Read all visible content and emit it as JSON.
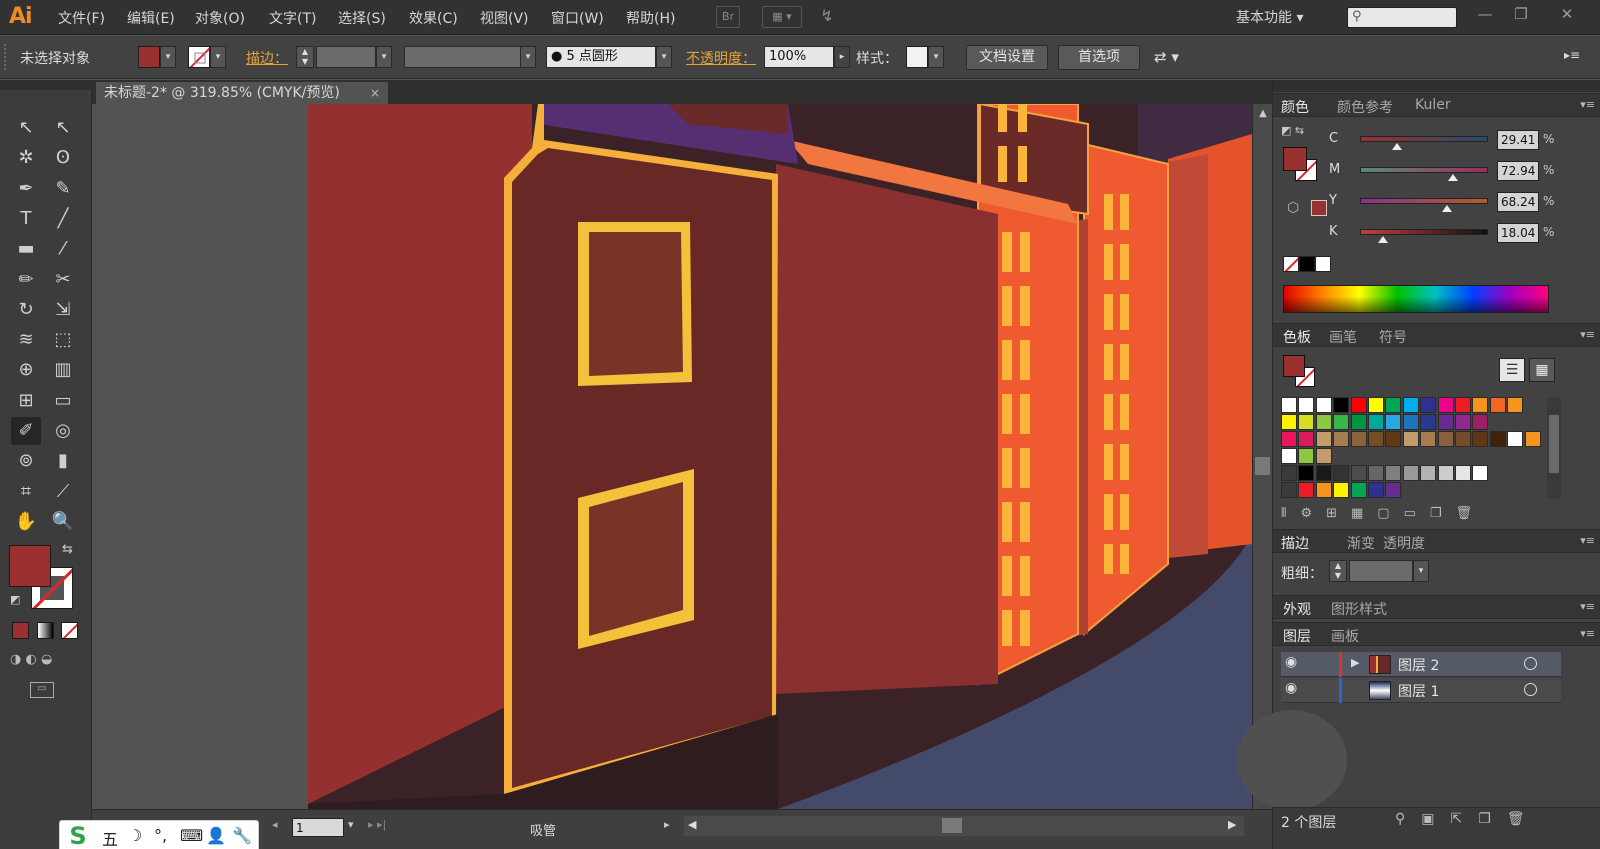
{
  "app": {
    "logo": "Ai",
    "menu": [
      "文件(F)",
      "编辑(E)",
      "对象(O)",
      "文字(T)",
      "选择(S)",
      "效果(C)",
      "视图(V)",
      "窗口(W)",
      "帮助(H)"
    ],
    "bridge_label": "Br",
    "workspace": "基本功能",
    "search_placeholder": "",
    "window_buttons": [
      "—",
      "❐",
      "✕"
    ]
  },
  "control_bar": {
    "selection_status": "未选择对象",
    "fill_color": "#9a3030",
    "stroke_label": "描边：",
    "brush_label": "5 点圆形",
    "opacity_label": "不透明度：",
    "opacity_value": "100%",
    "style_label": "样式：",
    "doc_setup_button": "文档设置",
    "preferences_button": "首选项"
  },
  "document": {
    "tab_title": "未标题-2* @ 319.85% (CMYK/预览)",
    "tab_close": "×",
    "page_number": "1",
    "status_tool": "吸管"
  },
  "ime": {
    "logo": "S",
    "items": [
      "五",
      "☽",
      "°,",
      "⌨",
      "👤",
      "🔧"
    ]
  },
  "toolbox": {
    "fill_color": "#9a3030",
    "tools": [
      {
        "name": "selection-tool",
        "glyph": "↖"
      },
      {
        "name": "direct-selection-tool",
        "glyph": "↖"
      },
      {
        "name": "magic-wand-tool",
        "glyph": "✲"
      },
      {
        "name": "lasso-tool",
        "glyph": "ʘ"
      },
      {
        "name": "pen-tool",
        "glyph": "✒"
      },
      {
        "name": "curvature-tool",
        "glyph": "✎"
      },
      {
        "name": "type-tool",
        "glyph": "T"
      },
      {
        "name": "line-tool",
        "glyph": "╱"
      },
      {
        "name": "rectangle-tool",
        "glyph": "▬"
      },
      {
        "name": "paintbrush-tool",
        "glyph": "⁄"
      },
      {
        "name": "pencil-tool",
        "glyph": "✏"
      },
      {
        "name": "scissors-tool",
        "glyph": "✂"
      },
      {
        "name": "rotate-tool",
        "glyph": "↻"
      },
      {
        "name": "scale-tool",
        "glyph": "⇲"
      },
      {
        "name": "warp-tool",
        "glyph": "≋"
      },
      {
        "name": "free-transform-tool",
        "glyph": "⬚"
      },
      {
        "name": "shape-builder-tool",
        "glyph": "⊕"
      },
      {
        "name": "perspective-grid-tool",
        "glyph": "▥"
      },
      {
        "name": "mesh-tool",
        "glyph": "⊞"
      },
      {
        "name": "gradient-tool",
        "glyph": "▭"
      },
      {
        "name": "eyedropper-tool",
        "glyph": "✐"
      },
      {
        "name": "blend-tool",
        "glyph": "◎"
      },
      {
        "name": "symbol-sprayer-tool",
        "glyph": "⊚"
      },
      {
        "name": "column-graph-tool",
        "glyph": "▮"
      },
      {
        "name": "artboard-tool",
        "glyph": "⌗"
      },
      {
        "name": "slice-tool",
        "glyph": "⟋"
      },
      {
        "name": "hand-tool",
        "glyph": "✋"
      },
      {
        "name": "zoom-tool",
        "glyph": "🔍"
      }
    ]
  },
  "color_panel": {
    "tabs": [
      "颜色",
      "颜色参考",
      "Kuler"
    ],
    "fill_color": "#9a3030",
    "sliders": [
      {
        "label": "C",
        "value": "29.41",
        "fraction": 0.29,
        "gradient": "linear-gradient(to right,#9a3030,#2a4a6a)"
      },
      {
        "label": "M",
        "value": "72.94",
        "fraction": 0.73,
        "gradient": "linear-gradient(to right,#5a8a7a,#a02a60)"
      },
      {
        "label": "Y",
        "value": "68.24",
        "fraction": 0.68,
        "gradient": "linear-gradient(to right,#8a3090,#b06020)"
      },
      {
        "label": "K",
        "value": "18.04",
        "fraction": 0.18,
        "gradient": "linear-gradient(to right,#c04040,#101010)"
      }
    ],
    "percent": "%"
  },
  "swatches_panel": {
    "tabs": [
      "色板",
      "画笔",
      "符号"
    ],
    "rows": [
      [
        "#ffffff",
        "#ffffff",
        "#ffffff",
        "#000000",
        "#ff0000",
        "#ffff00",
        "#00a651",
        "#00aeef",
        "#2e3192",
        "#ec008c",
        "#ed1c24",
        "#f7941d",
        "#f26522",
        "#f7941d"
      ],
      [
        "#fff200",
        "#d7df23",
        "#8dc63f",
        "#39b54a",
        "#009444",
        "#00a99d",
        "#27aae1",
        "#1c75bc",
        "#2b388f",
        "#662d91",
        "#92278f",
        "#9e1f63"
      ],
      [
        "#ed145b",
        "#da1c5c",
        "#c69c6d",
        "#a67c52",
        "#8c6239",
        "#754c24",
        "#603913",
        "#c49a6c",
        "#a97c50",
        "#8b5e3c",
        "#754c29",
        "#603813",
        "#42210b",
        "#ffffff",
        "#f7941d"
      ],
      [
        "#ffffff",
        "#8dc63f",
        "#c69c6d"
      ],
      [
        "#3a3a3a",
        "#000000",
        "#1a1a1a",
        "#333333",
        "#4d4d4d",
        "#666666",
        "#808080",
        "#999999",
        "#b3b3b3",
        "#cccccc",
        "#e6e6e6",
        "#ffffff"
      ],
      [
        "#3a3a3a",
        "#ed1c24",
        "#f7941d",
        "#fff200",
        "#00a651",
        "#2e3192",
        "#662d91"
      ]
    ]
  },
  "stroke_panel": {
    "tabs": [
      "描边",
      "渐变",
      "透明度"
    ],
    "weight_label": "粗细："
  },
  "appearance_panel": {
    "tabs": [
      "外观",
      "图形样式"
    ]
  },
  "layers_panel": {
    "tabs": [
      "图层",
      "画板"
    ],
    "layers": [
      {
        "name": "图层 2",
        "color": "#e03030"
      },
      {
        "name": "图层 1",
        "color": "#3060e0"
      }
    ],
    "count_label": "2 个图层"
  }
}
